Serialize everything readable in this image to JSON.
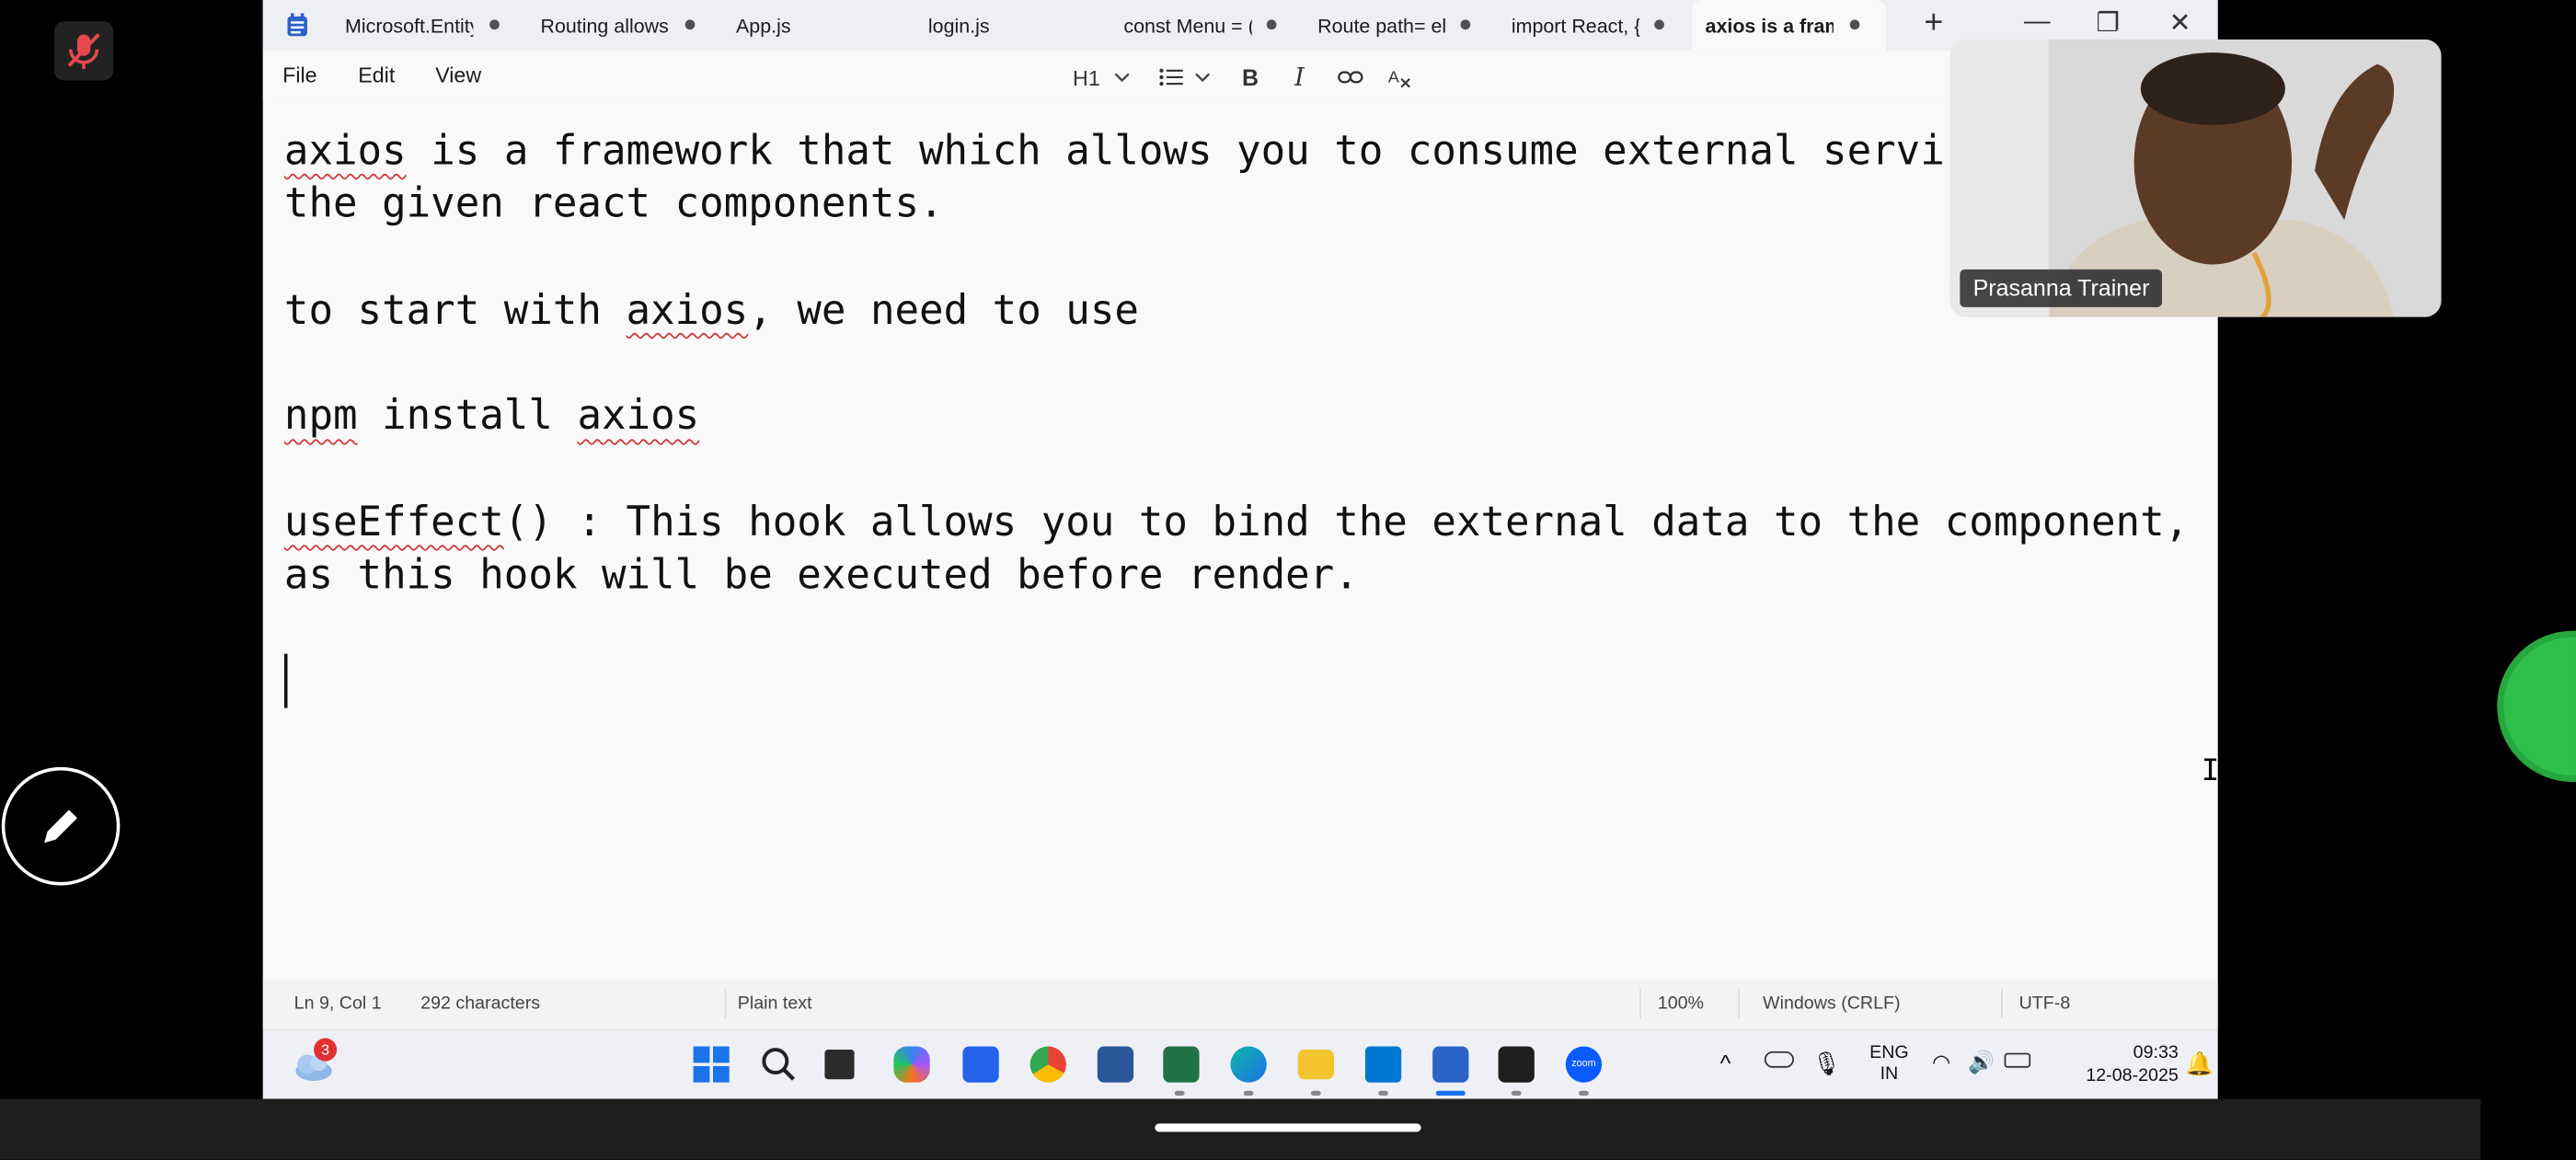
{
  "window": {
    "tabs": [
      {
        "label": "Microsoft.Entity",
        "modified": true
      },
      {
        "label": "Routing allows",
        "modified": true
      },
      {
        "label": "App.js",
        "modified": false
      },
      {
        "label": "login.js",
        "modified": false
      },
      {
        "label": "const Menu = (",
        "modified": true
      },
      {
        "label": "Route path= ele",
        "modified": true
      },
      {
        "label": "import React, {",
        "modified": true
      },
      {
        "label": "axios is a fram",
        "modified": true,
        "active": true
      }
    ],
    "new_tab": "+",
    "controls": {
      "minimize": "—",
      "maximize": "❐",
      "close": "✕"
    }
  },
  "menubar": {
    "file": "File",
    "edit": "Edit",
    "view": "View",
    "heading": "H1",
    "bold": "B",
    "italic": "I"
  },
  "document": {
    "lines": [
      [
        {
          "t": "axios",
          "s": true
        },
        {
          "t": " is a framework that which allows you to consume external servi"
        }
      ],
      [
        {
          "t": "the given react components."
        }
      ],
      [
        {
          "t": ""
        }
      ],
      [
        {
          "t": "to start with "
        },
        {
          "t": "axios",
          "s": true
        },
        {
          "t": ", we need to use"
        }
      ],
      [
        {
          "t": ""
        }
      ],
      [
        {
          "t": "npm",
          "s": true
        },
        {
          "t": " install "
        },
        {
          "t": "axios",
          "s": true
        }
      ],
      [
        {
          "t": ""
        }
      ],
      [
        {
          "t": "useEffect",
          "s": true
        },
        {
          "t": "() : This hook allows you to bind the external data to the component,"
        }
      ],
      [
        {
          "t": "as this hook will be executed before render."
        }
      ]
    ]
  },
  "status": {
    "position": "Ln 9, Col 1",
    "characters": "292 characters",
    "format": "Plain text",
    "zoom": "100%",
    "line_ending": "Windows (CRLF)",
    "encoding": "UTF-8"
  },
  "taskbar": {
    "weather_badge": "3",
    "lang_top": "ENG",
    "lang_bottom": "IN",
    "time": "09:33",
    "date": "12-08-2025",
    "zoom_label": "zoom"
  },
  "webcam": {
    "participant": "Prasanna Trainer"
  }
}
